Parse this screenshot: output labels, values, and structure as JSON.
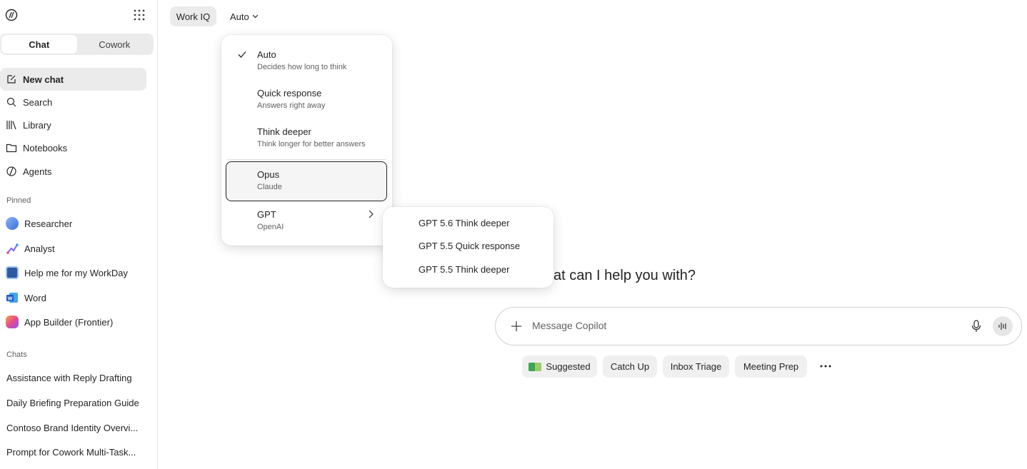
{
  "sidebar": {
    "tabs": [
      {
        "label": "Chat"
      },
      {
        "label": "Cowork"
      }
    ],
    "nav": [
      {
        "label": "New chat",
        "icon": "compose-icon"
      },
      {
        "label": "Search",
        "icon": "search-icon"
      },
      {
        "label": "Library",
        "icon": "library-icon"
      },
      {
        "label": "Notebooks",
        "icon": "folder-icon"
      },
      {
        "label": "Agents",
        "icon": "agents-icon"
      }
    ],
    "pinned_label": "Pinned",
    "pinned": [
      {
        "label": "Researcher",
        "color": "#5b8def"
      },
      {
        "label": "Analyst",
        "color": "#7b61ff"
      },
      {
        "label": "Help me for my WorkDay",
        "color": "#2c5aa0"
      },
      {
        "label": "Word",
        "color": "#185abd"
      },
      {
        "label": "App Builder (Frontier)",
        "color": "#e74c8c"
      }
    ],
    "chats_label": "Chats",
    "chats": [
      {
        "label": "Assistance with Reply Drafting"
      },
      {
        "label": "Daily Briefing Preparation Guide"
      },
      {
        "label": "Contoso Brand Identity Overvi..."
      },
      {
        "label": "Prompt for Cowork Multi-Task..."
      }
    ]
  },
  "topbar": {
    "workiq": "Work IQ",
    "mode": "Auto"
  },
  "menu": {
    "options": [
      {
        "title": "Auto",
        "subtitle": "Decides how long to think"
      },
      {
        "title": "Quick response",
        "subtitle": "Answers right away"
      },
      {
        "title": "Think deeper",
        "subtitle": "Think longer for better answers"
      },
      {
        "title": "Opus",
        "subtitle": "Claude"
      },
      {
        "title": "GPT",
        "subtitle": "OpenAI"
      }
    ],
    "submenu": [
      "GPT 5.6 Think deeper",
      "GPT 5.5 Quick response",
      "GPT 5.5 Think deeper"
    ]
  },
  "main": {
    "headline": "at can I help you with?",
    "composer_placeholder": "Message Copilot",
    "chips": [
      {
        "label": "Suggested"
      },
      {
        "label": "Catch Up"
      },
      {
        "label": "Inbox Triage"
      },
      {
        "label": "Meeting Prep"
      }
    ]
  },
  "colors": {
    "accent": "#242424",
    "chip_bg": "#f0f0f0",
    "sidebar_active": "#ebebeb"
  }
}
